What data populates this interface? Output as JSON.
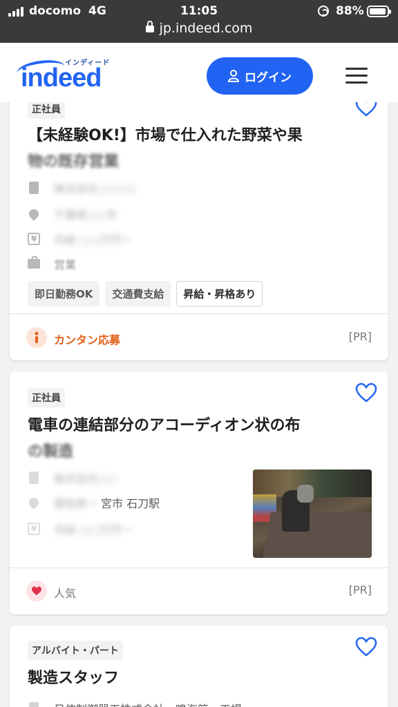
{
  "status_bar": {
    "carrier": "docomo",
    "network": "4G",
    "time": "11:05",
    "battery": "88%",
    "url": "jp.indeed.com"
  },
  "header": {
    "logo_text": "indeed",
    "logo_kana": "インディード",
    "login_label": "ログイン",
    "brand_color": "#2164f3"
  },
  "cards": [
    {
      "employment_type": "正社員",
      "title_visible": "【未経験OK!】市場で仕入れた野菜や果",
      "title_blurred": "物の既存営業",
      "company_blurred": "株式会社○○○○",
      "location_blurred": "千葉県○○市",
      "salary_blurred": "月給 ○○万円〜",
      "category": "営業",
      "tags": [
        "即日勤務OK",
        "交通費支給",
        "昇給・昇格あり"
      ],
      "footer_label": "カンタン応募",
      "footer_color": "#e4601a",
      "pr": "[PR]"
    },
    {
      "employment_type": "正社員",
      "title_visible": "電車の連結部分のアコーディオン状の布",
      "title_blurred": "の製造",
      "company_blurred": "株式会社○○",
      "location_blurred": "愛知県一",
      "location_visible": "宮市 石刀駅",
      "salary_blurred": "月給 ○○万円〜",
      "footer_label": "人気",
      "footer_color": "#e0304a",
      "pr": "[PR]"
    },
    {
      "employment_type": "アルバイト・パート",
      "title_visible": "製造スタッフ",
      "company_partial": "日伸制御器工株式会社　鳴海第一工場"
    }
  ]
}
